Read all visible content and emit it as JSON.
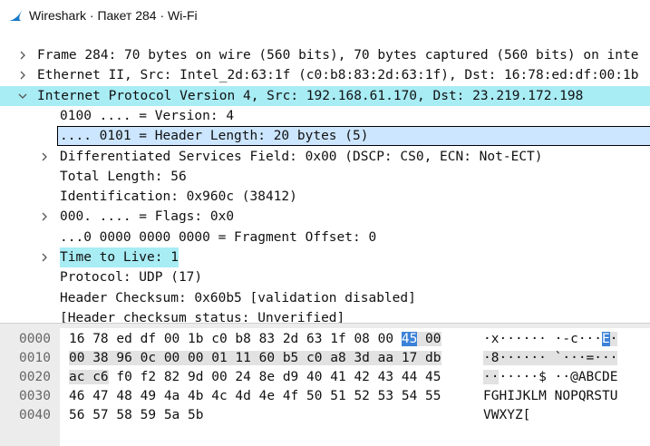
{
  "window": {
    "title": "Wireshark · Пакет 284 · Wi-Fi"
  },
  "colors": {
    "highlight": "#a8ecf4",
    "selection": "#cce6ff",
    "hex_selected": "#3b82d8"
  },
  "details": [
    {
      "text": "Frame 284: 70 bytes on wire (560 bits), 70 bytes captured (560 bits) on inte",
      "arrow": "right",
      "indent": 0
    },
    {
      "text": "Ethernet II, Src: Intel_2d:63:1f (c0:b8:83:2d:63:1f), Dst: 16:78:ed:df:00:1b",
      "arrow": "right",
      "indent": 0
    },
    {
      "text": "Internet Protocol Version 4, Src: 192.168.61.170, Dst: 23.219.172.198",
      "arrow": "down",
      "indent": 0
    },
    {
      "text": "0100 .... = Version: 4",
      "arrow": "",
      "indent": 1
    },
    {
      "text": ".... 0101 = Header Length: 20 bytes (5)",
      "arrow": "",
      "indent": 1
    },
    {
      "text": "Differentiated Services Field: 0x00 (DSCP: CS0, ECN: Not-ECT)",
      "arrow": "right",
      "indent": 1
    },
    {
      "text": "Total Length: 56",
      "arrow": "",
      "indent": 1
    },
    {
      "text": "Identification: 0x960c (38412)",
      "arrow": "",
      "indent": 1
    },
    {
      "text": "000. .... = Flags: 0x0",
      "arrow": "right",
      "indent": 1
    },
    {
      "text": "...0 0000 0000 0000 = Fragment Offset: 0",
      "arrow": "",
      "indent": 1
    },
    {
      "text": "Time to Live: 1",
      "arrow": "right",
      "indent": 1
    },
    {
      "text": "Protocol: UDP (17)",
      "arrow": "",
      "indent": 1
    },
    {
      "text": "Header Checksum: 0x60b5 [validation disabled]",
      "arrow": "",
      "indent": 1
    },
    {
      "text": "[Header checksum status: Unverified]",
      "arrow": "",
      "indent": 1
    }
  ],
  "hex": [
    {
      "offset": "0000",
      "bytes": [
        "16",
        "78",
        "ed",
        "df",
        "00",
        "1b",
        "c0",
        "b8",
        "83",
        "2d",
        "63",
        "1f",
        "08",
        "00",
        "45",
        "00"
      ],
      "ascii": [
        "·",
        "x",
        "·",
        "·",
        "·",
        "·",
        "·",
        "·",
        "·",
        "-",
        "c",
        "·",
        "·",
        "·",
        "E",
        "·"
      ]
    },
    {
      "offset": "0010",
      "bytes": [
        "00",
        "38",
        "96",
        "0c",
        "00",
        "00",
        "01",
        "11",
        "60",
        "b5",
        "c0",
        "a8",
        "3d",
        "aa",
        "17",
        "db"
      ],
      "ascii": [
        "·",
        "8",
        "·",
        "·",
        "·",
        "·",
        "·",
        "·",
        "`",
        "·",
        "·",
        "·",
        "=",
        "·",
        "·",
        "·"
      ]
    },
    {
      "offset": "0020",
      "bytes": [
        "ac",
        "c6",
        "f0",
        "f2",
        "82",
        "9d",
        "00",
        "24",
        "8e",
        "d9",
        "40",
        "41",
        "42",
        "43",
        "44",
        "45"
      ],
      "ascii": [
        "·",
        "·",
        "·",
        "·",
        "·",
        "·",
        "·",
        "$",
        "·",
        "·",
        "@",
        "A",
        "B",
        "C",
        "D",
        "E"
      ]
    },
    {
      "offset": "0030",
      "bytes": [
        "46",
        "47",
        "48",
        "49",
        "4a",
        "4b",
        "4c",
        "4d",
        "4e",
        "4f",
        "50",
        "51",
        "52",
        "53",
        "54",
        "55"
      ],
      "ascii": [
        "F",
        "G",
        "H",
        "I",
        "J",
        "K",
        "L",
        "M",
        "N",
        "O",
        "P",
        "Q",
        "R",
        "S",
        "T",
        "U"
      ]
    },
    {
      "offset": "0040",
      "bytes": [
        "56",
        "57",
        "58",
        "59",
        "5a",
        "5b"
      ],
      "ascii": [
        "V",
        "W",
        "X",
        "Y",
        "Z",
        "["
      ]
    }
  ]
}
